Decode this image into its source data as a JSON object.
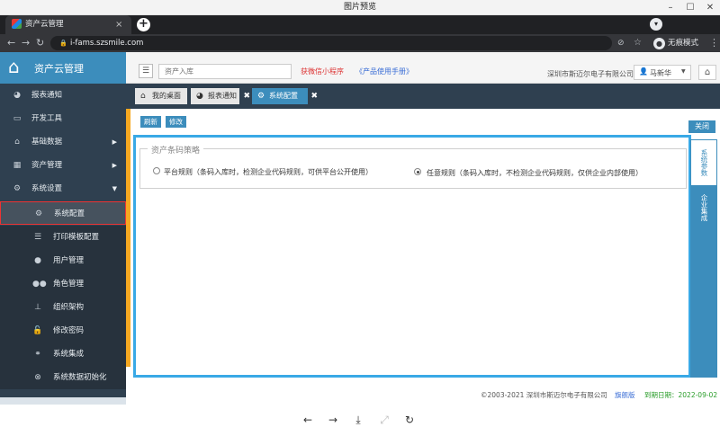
{
  "viewer": {
    "title": "图片预览"
  },
  "browser": {
    "tab_title": "资产云管理",
    "url": "i-fams.szsmile.com",
    "incognito_label": "无痕模式"
  },
  "app": {
    "logo_text": "资产云管理"
  },
  "sidebar": {
    "items": [
      {
        "label": "报表通知",
        "icon": "dashboard-icon"
      },
      {
        "label": "开发工具",
        "icon": "laptop-icon"
      },
      {
        "label": "基础数据",
        "icon": "home-icon",
        "has_arrow": true
      },
      {
        "label": "资产管理",
        "icon": "grid-icon",
        "has_arrow": true
      },
      {
        "label": "系统设置",
        "icon": "cogs-icon",
        "expanded": true
      }
    ],
    "subitems": [
      {
        "label": "系统配置",
        "icon": "cogs-icon",
        "active": true
      },
      {
        "label": "打印模板配置",
        "icon": "list-icon"
      },
      {
        "label": "用户管理",
        "icon": "user-icon"
      },
      {
        "label": "角色管理",
        "icon": "users-icon"
      },
      {
        "label": "组织架构",
        "icon": "sitemap-icon"
      },
      {
        "label": "修改密码",
        "icon": "lock-icon"
      },
      {
        "label": "系统集成",
        "icon": "link-icon"
      },
      {
        "label": "系统数据初始化",
        "icon": "times-circle-icon"
      }
    ]
  },
  "header": {
    "search_placeholder": "资产入库",
    "wechat_link": "获微信小程序",
    "manual_link": "《产品使用手册》",
    "company": "深圳市斯迈尔电子有限公司",
    "user_name": "马新华"
  },
  "tabs": [
    {
      "label": "我的桌面"
    },
    {
      "label": "报表通知"
    },
    {
      "label": "系统配置",
      "active": true
    }
  ],
  "toolbar": {
    "refresh": "刷新",
    "edit": "修改",
    "close": "关闭"
  },
  "strategy": {
    "legend": "资产条码策略",
    "options": [
      {
        "label": "平台规则（条码入库时，检测企业代码规则，可供平台公开使用）",
        "selected": false
      },
      {
        "label": "任意规则（条码入库时，不检测企业代码规则，仅供企业内部使用）",
        "selected": true
      }
    ]
  },
  "side_tabs": {
    "system_params": "系统参数",
    "entity": "企业集成"
  },
  "footer": {
    "copyright": "©2003-2021 深圳市斯迈尔电子有限公司",
    "edition": "旗舰版",
    "expire": "到期日期：2022-09-02"
  },
  "colors": {
    "primary": "#3c8dbc",
    "sidebar": "#2f4050",
    "accent_orange": "#f6a821",
    "panel_border": "#39a9e6"
  }
}
